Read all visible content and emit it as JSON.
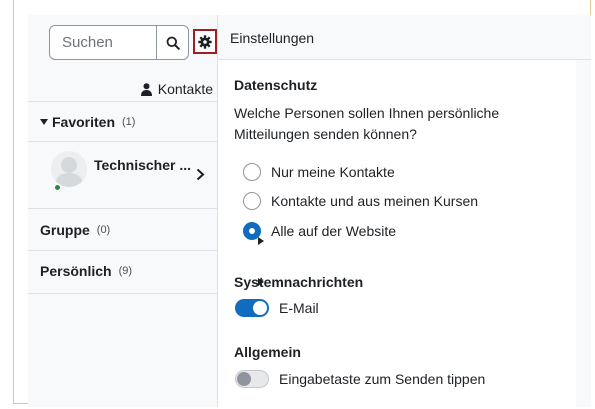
{
  "search": {
    "placeholder": "Suchen",
    "button_icon": "search-icon"
  },
  "settings_icon": "gear-icon",
  "sidebar": {
    "contacts_label": "Kontakte",
    "sections": [
      {
        "label": "Favoriten",
        "count": "(1)",
        "expanded": true
      },
      {
        "label": "Gruppe",
        "count": "(0)",
        "expanded": false
      },
      {
        "label": "Persönlich",
        "count": "(9)",
        "expanded": false
      }
    ],
    "favorite_contact": {
      "name": "Technischer ...",
      "online": true
    }
  },
  "panel": {
    "title": "Einstellungen",
    "privacy": {
      "heading": "Datenschutz",
      "question": "Welche Personen sollen Ihnen persönliche Mitteilungen senden können?",
      "options": [
        {
          "label": "Nur meine Kontakte",
          "checked": false
        },
        {
          "label": "Kontakte und aus meinen Kursen",
          "checked": false
        },
        {
          "label": "Alle auf der Website",
          "checked": true
        }
      ]
    },
    "notifications": {
      "heading": "Systemnachrichten",
      "email_label": "E-Mail",
      "email_on": true
    },
    "general": {
      "heading": "Allgemein",
      "enter_label": "Eingabetaste zum Senden tippen",
      "enter_on": false
    }
  },
  "colors": {
    "accent": "#0f6cbf",
    "highlight_border": "#a11d21",
    "online": "#2a8a3c"
  }
}
